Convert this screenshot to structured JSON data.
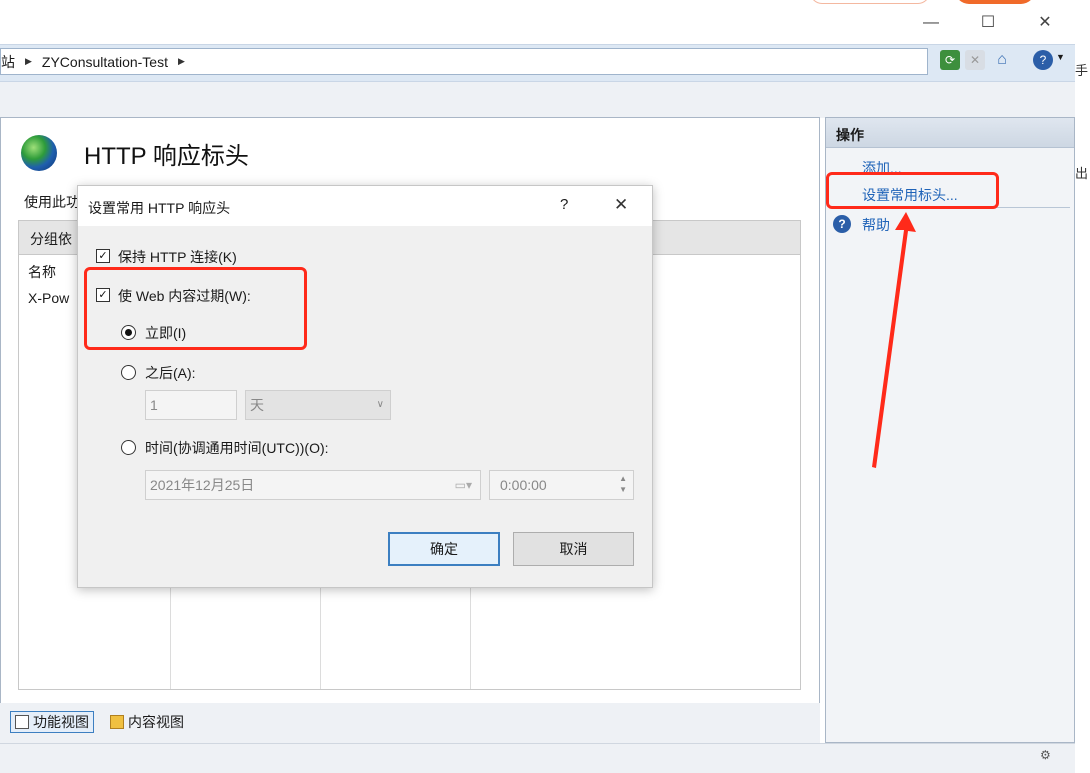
{
  "window": {
    "minimize_glyph": "—",
    "maximize_glyph": "☐",
    "close_glyph": "✕"
  },
  "addressbar": {
    "crumbs": [
      "站",
      "ZYConsultation-Test"
    ],
    "arrow": "▶",
    "right_edge_text": "手",
    "far_right_text": "出"
  },
  "page": {
    "title": "HTTP 响应标头",
    "description": "使用此功",
    "group_label": "分组依",
    "col_name": "名称",
    "row0_name": "X-Pow"
  },
  "views": {
    "features": "功能视图",
    "content": "内容视图"
  },
  "actions": {
    "title": "操作",
    "add": "添加...",
    "set_common": "设置常用标头...",
    "help": "帮助",
    "help_icon": "?"
  },
  "dialog": {
    "title": "设置常用 HTTP 响应头",
    "help_glyph": "?",
    "close_glyph": "✕",
    "keep_alive_label": "保持 HTTP 连接(K)",
    "keep_alive_checked": true,
    "expire_label": "使 Web 内容过期(W):",
    "expire_checked": true,
    "immediate_label": "立即(I)",
    "after_label": "之后(A):",
    "after_value": "1",
    "after_unit": "天",
    "time_label": "时间(协调通用时间(UTC))(O):",
    "date_value": "2021年12月25日",
    "time_value": "0:00:00",
    "ok": "确定",
    "cancel": "取消"
  },
  "colors": {
    "annotation": "#ff2a1a",
    "link": "#1f63b8",
    "accent": "#3c7fc1"
  }
}
